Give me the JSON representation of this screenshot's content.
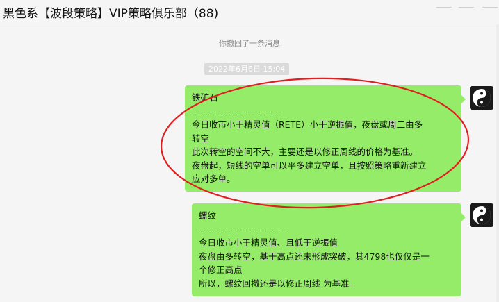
{
  "window": {
    "title": "黑色系【波段策略】VIP策略俱乐部（88)"
  },
  "chat": {
    "system_message": "你撤回了一条消息",
    "timestamp": "2022年6月6日 15:04",
    "messages": [
      {
        "lines": [
          "铁矿石",
          "----------------------------",
          "今日收市小于精灵值（RETE）小于逆振值，夜盘或周二由多",
          "转空",
          "此次转空的空间不大，主要还是以修正周线的价格为基准。",
          "夜盘起，短线的空单可以平多建立空单，且按照策略重新建立",
          "应对多单。"
        ],
        "avatar_icon": "yin-yang-icon"
      },
      {
        "lines": [
          "螺纹",
          "----------------------------",
          "今日收市小于精灵值、且低于逆振值",
          "夜盘由多转空，基于高点还未形成突破，其4798也仅仅是一",
          "个修正高点",
          "所以，螺纹回撤还是以修正周线 为基准。"
        ],
        "avatar_icon": "yin-yang-icon"
      }
    ]
  },
  "colors": {
    "bubble": "#95ec69",
    "annotation_circle": "#e02020",
    "background": "#f5f5f5"
  }
}
